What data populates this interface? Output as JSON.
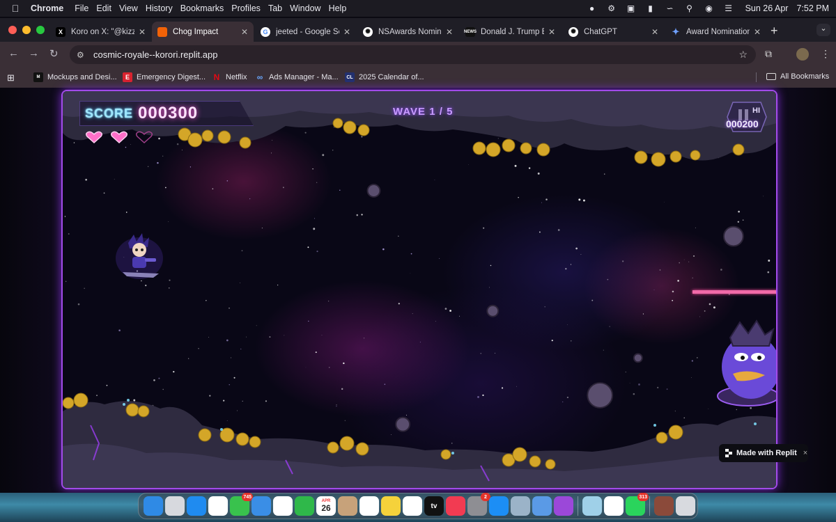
{
  "menubar": {
    "app": "Chrome",
    "items": [
      "File",
      "Edit",
      "View",
      "History",
      "Bookmarks",
      "Profiles",
      "Tab",
      "Window",
      "Help"
    ],
    "date": "Sun 26 Apr",
    "time": "7:52 PM"
  },
  "tabs": [
    {
      "title": "Koro on X: \"@kizzy",
      "favicon": "x-logo",
      "color": "#000000"
    },
    {
      "title": "Chog Impact",
      "favicon": "replit-logo",
      "color": "#f26207",
      "active": true
    },
    {
      "title": "jeeted - Google Se",
      "favicon": "google-logo",
      "color": "#ffffff"
    },
    {
      "title": "NSAwards Nomine",
      "favicon": "chatgpt-logo",
      "color": "#ffffff"
    },
    {
      "title": "Donald J. Trump Bi",
      "favicon": "news-logo",
      "color": "#111111"
    },
    {
      "title": "ChatGPT",
      "favicon": "chatgpt-logo",
      "color": "#ffffff"
    },
    {
      "title": "Award Nomination",
      "favicon": "gemini-logo",
      "color": "#4a7cf0"
    }
  ],
  "address_bar": {
    "url": "cosmic-royale--korori.replit.app"
  },
  "bookmarks": [
    {
      "label": "Mockups and Desi...",
      "icon": "mockups-icon",
      "color": "#111111"
    },
    {
      "label": "Emergency Digest...",
      "icon": "emergency-icon",
      "color": "#d9232e"
    },
    {
      "label": "Netflix",
      "icon": "netflix-icon",
      "color": "#e50914"
    },
    {
      "label": "Ads Manager - Ma...",
      "icon": "meta-icon",
      "color": "#1877f2"
    },
    {
      "label": "2025 Calendar of...",
      "icon": "calendar-icon",
      "color": "#22306e"
    }
  ],
  "all_bookmarks": "All Bookmarks",
  "game": {
    "score_label": "SCORE",
    "score": "000300",
    "wave": "WAVE 1 / 5",
    "hi_label": "HI",
    "hi_score": "000200",
    "lives_total": 3,
    "lives_remaining": 2,
    "boss_health_fraction": 1.0
  },
  "replit_badge": {
    "label": "Made with Replit",
    "close": "×"
  },
  "dock": {
    "apps": [
      {
        "name": "finder",
        "color": "#2f8ae5"
      },
      {
        "name": "launchpad",
        "color": "#d7d9de"
      },
      {
        "name": "safari",
        "color": "#1f8bf0"
      },
      {
        "name": "chrome",
        "color": "#ffffff"
      },
      {
        "name": "messages",
        "color": "#39c24d",
        "badge": "745"
      },
      {
        "name": "mail",
        "color": "#3a8ee6"
      },
      {
        "name": "photos",
        "color": "#ffffff"
      },
      {
        "name": "facetime",
        "color": "#2fb84a"
      },
      {
        "name": "calendar",
        "color": "#ffffff",
        "month": "APR",
        "day": "26"
      },
      {
        "name": "contacts",
        "color": "#c7a27a"
      },
      {
        "name": "reminders",
        "color": "#ffffff"
      },
      {
        "name": "notes",
        "color": "#f5d23b"
      },
      {
        "name": "freeform",
        "color": "#ffffff"
      },
      {
        "name": "tv",
        "color": "#111111",
        "label": "tv"
      },
      {
        "name": "music",
        "color": "#f23b52"
      },
      {
        "name": "system-settings",
        "color": "#8e8e93",
        "badge": "2"
      },
      {
        "name": "app-store",
        "color": "#1c8ef5"
      },
      {
        "name": "disk-utility",
        "color": "#9bb3c8"
      },
      {
        "name": "preview",
        "color": "#5a9ae6"
      },
      {
        "name": "podcasts",
        "color": "#9b48d9"
      }
    ],
    "recent": [
      {
        "name": "finder-window",
        "color": "#9fd0e8"
      },
      {
        "name": "wordpress",
        "color": "#ffffff"
      },
      {
        "name": "whatsapp",
        "color": "#2ad45c",
        "badge": "313"
      }
    ],
    "trash": [
      {
        "name": "downloads-stack",
        "color": "#8b4a3a"
      },
      {
        "name": "trash",
        "color": "#d8dadf"
      }
    ]
  }
}
